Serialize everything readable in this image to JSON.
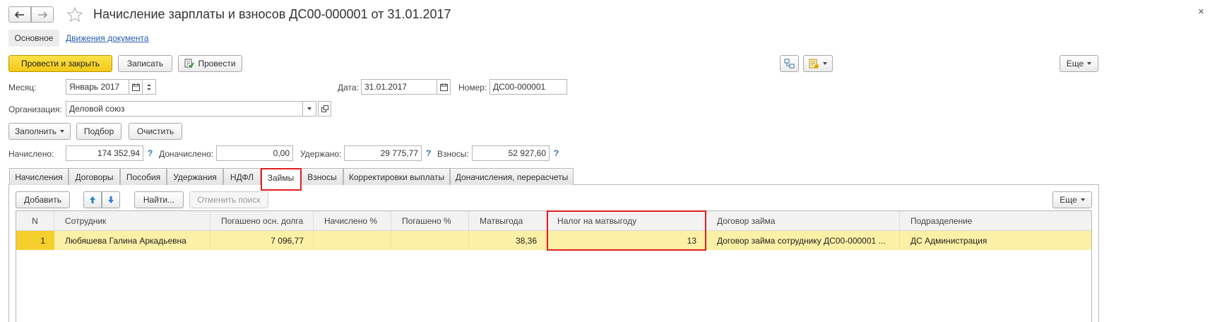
{
  "window": {
    "title": "Начисление зарплаты и взносов ДС00-000001 от 31.01.2017",
    "close_glyph": "×"
  },
  "nav": {
    "tab_main": "Основное",
    "tab_movements": "Движения документа"
  },
  "toolbar": {
    "post_close": "Провести и закрыть",
    "save": "Записать",
    "post": "Провести",
    "more": "Еще"
  },
  "fields": {
    "month_label": "Месяц:",
    "month_value": "Январь 2017",
    "date_label": "Дата:",
    "date_value": "31.01.2017",
    "number_label": "Номер:",
    "number_value": "ДС00-000001",
    "org_label": "Организация:",
    "org_value": "Деловой союз"
  },
  "actions": {
    "fill": "Заполнить",
    "select": "Подбор",
    "clear": "Очистить"
  },
  "totals": {
    "accrued_label": "Начислено:",
    "accrued_value": "174 352,94",
    "additional_label": "Доначислено:",
    "additional_value": "0,00",
    "withheld_label": "Удержано:",
    "withheld_value": "29 775,77",
    "contrib_label": "Взносы:",
    "contrib_value": "52 927,60",
    "help": "?"
  },
  "tabs": [
    "Начисления",
    "Договоры",
    "Пособия",
    "Удержания",
    "НДФЛ",
    "Займы",
    "Взносы",
    "Корректировки выплаты",
    "Доначисления, перерасчеты"
  ],
  "active_tab": "Займы",
  "table_toolbar": {
    "add": "Добавить",
    "find": "Найти...",
    "cancel_search": "Отменить поиск",
    "more": "Еще"
  },
  "table": {
    "columns": [
      "N",
      "Сотрудник",
      "Погашено осн. долга",
      "Начислено %",
      "Погашено %",
      "Матвыгода",
      "Налог на матвыгоду",
      "Договор займа",
      "Подразделение"
    ],
    "rows": [
      {
        "n": "1",
        "employee": "Любяшева Галина Аркадьевна",
        "principal_repaid": "7 096,77",
        "interest_accrued": "",
        "interest_repaid": "",
        "mat_benefit": "38,36",
        "tax_mat_benefit": "13",
        "loan_contract": "Договор займа сотруднику ДС00-000001 ...",
        "department": "ДС Администрация"
      }
    ]
  },
  "colors": {
    "accent_yellow": "#f5d02c",
    "selected_row": "#fbf0a6",
    "highlight_red": "#e02020",
    "link_blue": "#2a5db0"
  }
}
